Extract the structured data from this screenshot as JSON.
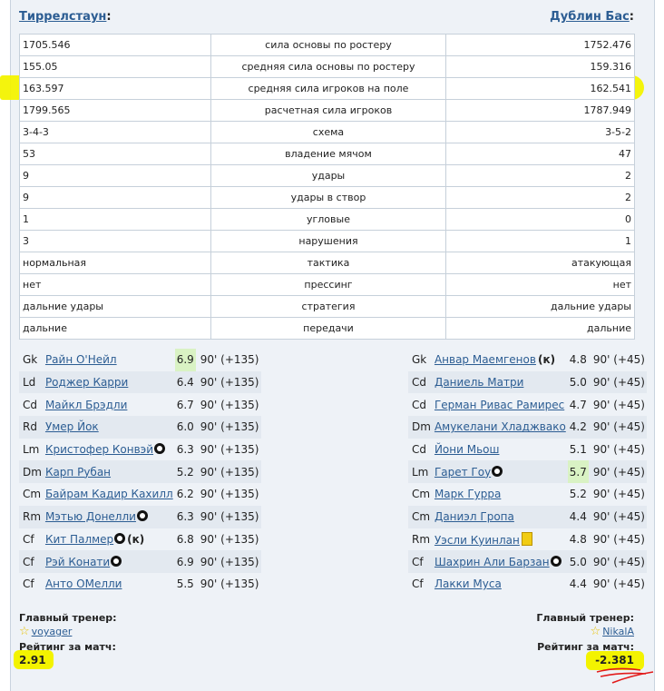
{
  "teams": {
    "home": "Тиррелстаун",
    "away": "Дублин Бас",
    "colon": ":"
  },
  "stats": [
    {
      "left": "1705.546",
      "label": "сила основы по ростеру",
      "right": "1752.476"
    },
    {
      "left": "155.05",
      "label": "средняя сила основы по ростеру",
      "right": "159.316"
    },
    {
      "left": "163.597",
      "label": "средняя сила игроков на поле",
      "right": "162.541"
    },
    {
      "left": "1799.565",
      "label": "расчетная сила игроков",
      "right": "1787.949"
    },
    {
      "left": "3-4-3",
      "label": "схема",
      "right": "3-5-2"
    },
    {
      "left": "53",
      "label": "владение мячом",
      "right": "47"
    },
    {
      "left": "9",
      "label": "удары",
      "right": "2"
    },
    {
      "left": "9",
      "label": "удары в створ",
      "right": "2"
    },
    {
      "left": "1",
      "label": "угловые",
      "right": "0"
    },
    {
      "left": "3",
      "label": "нарушения",
      "right": "1"
    },
    {
      "left": "нормальная",
      "label": "тактика",
      "right": "атакующая"
    },
    {
      "left": "нет",
      "label": "прессинг",
      "right": "нет"
    },
    {
      "left": "дальние удары",
      "label": "стратегия",
      "right": "дальние удары"
    },
    {
      "left": "дальние",
      "label": "передачи",
      "right": "дальние"
    }
  ],
  "home_players": [
    {
      "pos": "Gk",
      "name": "Райн О'Нейл",
      "rating": "6.9",
      "time": "90' (+135)"
    },
    {
      "pos": "Ld",
      "name": "Роджер Карри",
      "rating": "6.4",
      "time": "90' (+135)"
    },
    {
      "pos": "Cd",
      "name": "Майкл Брэдли",
      "rating": "6.7",
      "time": "90' (+135)"
    },
    {
      "pos": "Rd",
      "name": "Умер Йок",
      "rating": "6.0",
      "time": "90' (+135)"
    },
    {
      "pos": "Lm",
      "name": "Кристофер Конвэй",
      "rating": "6.3",
      "time": "90' (+135)"
    },
    {
      "pos": "Dm",
      "name": "Карп Рубан",
      "rating": "5.2",
      "time": "90' (+135)"
    },
    {
      "pos": "Cm",
      "name": "Байрам Кадир Кахилл",
      "rating": "6.2",
      "time": "90' (+135)"
    },
    {
      "pos": "Rm",
      "name": "Мэтью Донелли",
      "rating": "6.3",
      "time": "90' (+135)"
    },
    {
      "pos": "Cf",
      "name": "Кит Палмер",
      "rating": "6.8",
      "time": "90' (+135)"
    },
    {
      "pos": "Cf",
      "name": "Рэй Конати",
      "rating": "6.9",
      "time": "90' (+135)"
    },
    {
      "pos": "Cf",
      "name": "Анто ОМелли",
      "rating": "5.5",
      "time": "90' (+135)"
    }
  ],
  "away_players": [
    {
      "pos": "Gk",
      "name": "Анвар Маемгенов",
      "rating": "4.8",
      "time": "90' (+45)"
    },
    {
      "pos": "Cd",
      "name": "Даниель Матри",
      "rating": "5.0",
      "time": "90' (+45)"
    },
    {
      "pos": "Cd",
      "name": "Герман Ривас Рамирес",
      "rating": "4.7",
      "time": "90' (+45)"
    },
    {
      "pos": "Dm",
      "name": "Амукелани Хладжвако",
      "rating": "4.2",
      "time": "90' (+45)"
    },
    {
      "pos": "Cd",
      "name": "Йони Мьош",
      "rating": "5.1",
      "time": "90' (+45)"
    },
    {
      "pos": "Lm",
      "name": "Гарет Гоу",
      "rating": "5.7",
      "time": "90' (+45)"
    },
    {
      "pos": "Cm",
      "name": "Марк Гурра",
      "rating": "5.2",
      "time": "90' (+45)"
    },
    {
      "pos": "Cm",
      "name": "Даниэл Гропа",
      "rating": "4.4",
      "time": "90' (+45)"
    },
    {
      "pos": "Rm",
      "name": "Уэсли Куинлан",
      "rating": "4.8",
      "time": "90' (+45)"
    },
    {
      "pos": "Cf",
      "name": "Шахрин Али Барзан",
      "rating": "5.0",
      "time": "90' (+45)"
    },
    {
      "pos": "Cf",
      "name": "Лакки Муса",
      "rating": "4.4",
      "time": "90' (+45)"
    }
  ],
  "captain_mark": "(к)",
  "coach": {
    "title": "Главный тренер:",
    "home": "voyager",
    "away": "NikalA",
    "star": "☆"
  },
  "rating": {
    "title": "Рейтинг за матч:",
    "home": "2.91",
    "away": "-2.381"
  }
}
